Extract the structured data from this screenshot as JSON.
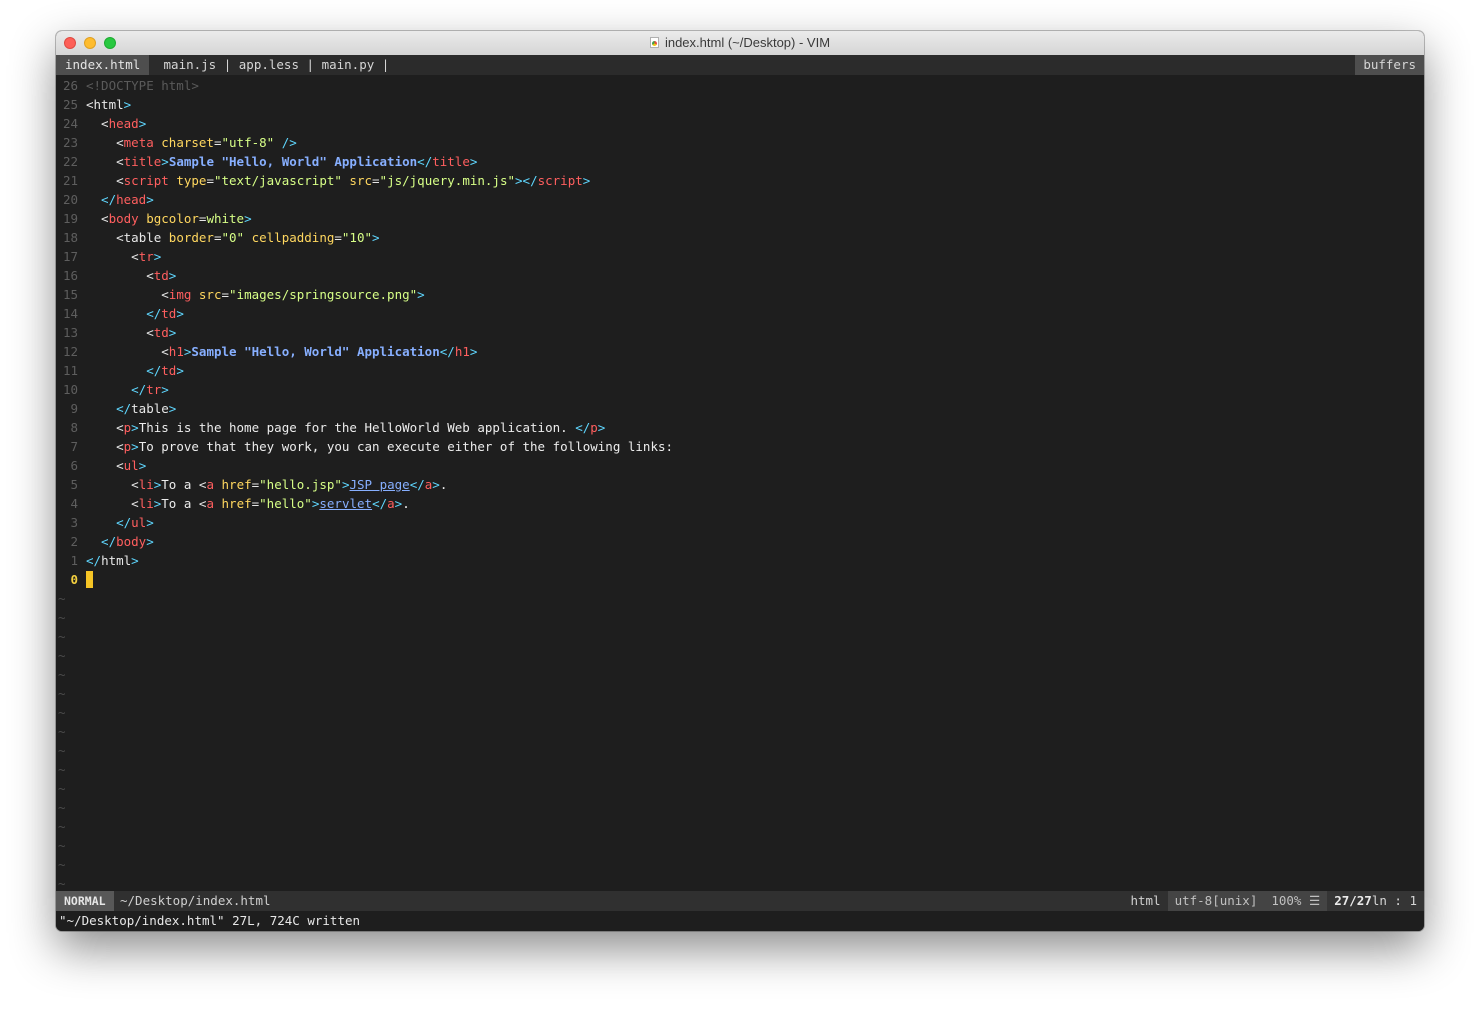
{
  "window": {
    "title": "index.html (~/Desktop) - VIM"
  },
  "tabline": {
    "active_tab": "index.html",
    "other_tabs": " main.js | app.less | main.py |",
    "buffers_label": "buffers"
  },
  "editor": {
    "lines": [
      {
        "num": "26",
        "segs": [
          [
            "<!DOCTYPE html>",
            "#5a5a5a"
          ]
        ]
      },
      {
        "num": "25",
        "segs": [
          [
            "<",
            "#e6e6e6"
          ],
          [
            "html",
            "#e8e8e8"
          ],
          [
            ">",
            "#5fd7ff"
          ]
        ]
      },
      {
        "num": "24",
        "segs": [
          [
            "  <",
            "#e6e6e6"
          ],
          [
            "head",
            "#ff5f5f"
          ],
          [
            ">",
            "#5fd7ff"
          ]
        ]
      },
      {
        "num": "23",
        "segs": [
          [
            "    <",
            "#e6e6e6"
          ],
          [
            "meta ",
            "#ff5f5f"
          ],
          [
            "charset",
            "#ffd75f"
          ],
          [
            "=",
            "#e6e6e6"
          ],
          [
            "\"utf-8\"",
            "#d7ff87"
          ],
          [
            " />",
            "#5fd7ff"
          ]
        ]
      },
      {
        "num": "22",
        "segs": [
          [
            "    <",
            "#e6e6e6"
          ],
          [
            "title",
            "#ff5f5f"
          ],
          [
            ">",
            "#5fd7ff"
          ],
          [
            "Sample \"Hello, World\" Application",
            "#87afff",
            "bold"
          ],
          [
            "</",
            "#5fd7ff"
          ],
          [
            "title",
            "#ff5f5f"
          ],
          [
            ">",
            "#5fd7ff"
          ]
        ]
      },
      {
        "num": "21",
        "segs": [
          [
            "    <",
            "#e6e6e6"
          ],
          [
            "script ",
            "#ff5f5f"
          ],
          [
            "type",
            "#ffd75f"
          ],
          [
            "=",
            "#e6e6e6"
          ],
          [
            "\"text/javascript\"",
            "#d7ff87"
          ],
          [
            " src",
            "#ffd75f"
          ],
          [
            "=",
            "#e6e6e6"
          ],
          [
            "\"js/jquery.min.js\"",
            "#d7ff87"
          ],
          [
            ">",
            "#5fd7ff"
          ],
          [
            "</",
            "#5fd7ff"
          ],
          [
            "script",
            "#ff5f5f"
          ],
          [
            ">",
            "#5fd7ff"
          ]
        ]
      },
      {
        "num": "20",
        "segs": [
          [
            "  </",
            "#5fd7ff"
          ],
          [
            "head",
            "#ff5f5f"
          ],
          [
            ">",
            "#5fd7ff"
          ]
        ]
      },
      {
        "num": "19",
        "segs": [
          [
            "  <",
            "#e6e6e6"
          ],
          [
            "body ",
            "#ff5f5f"
          ],
          [
            "bgcolor",
            "#ffd75f"
          ],
          [
            "=",
            "#e6e6e6"
          ],
          [
            "white",
            "#d7ff87"
          ],
          [
            ">",
            "#5fd7ff"
          ]
        ]
      },
      {
        "num": "18",
        "segs": [
          [
            "    <",
            "#e6e6e6"
          ],
          [
            "table ",
            "#e8e8e8"
          ],
          [
            "border",
            "#ffd75f"
          ],
          [
            "=",
            "#e6e6e6"
          ],
          [
            "\"0\"",
            "#d7ff87"
          ],
          [
            " cellpadding",
            "#ffd75f"
          ],
          [
            "=",
            "#e6e6e6"
          ],
          [
            "\"10\"",
            "#d7ff87"
          ],
          [
            ">",
            "#5fd7ff"
          ]
        ]
      },
      {
        "num": "17",
        "segs": [
          [
            "      <",
            "#e6e6e6"
          ],
          [
            "tr",
            "#ff5f5f"
          ],
          [
            ">",
            "#5fd7ff"
          ]
        ]
      },
      {
        "num": "16",
        "segs": [
          [
            "        <",
            "#e6e6e6"
          ],
          [
            "td",
            "#ff5f5f"
          ],
          [
            ">",
            "#5fd7ff"
          ]
        ]
      },
      {
        "num": "15",
        "segs": [
          [
            "          <",
            "#e6e6e6"
          ],
          [
            "img ",
            "#ff5f5f"
          ],
          [
            "src",
            "#ffd75f"
          ],
          [
            "=",
            "#e6e6e6"
          ],
          [
            "\"images/springsource.png\"",
            "#d7ff87"
          ],
          [
            ">",
            "#5fd7ff"
          ]
        ]
      },
      {
        "num": "14",
        "segs": [
          [
            "        </",
            "#5fd7ff"
          ],
          [
            "td",
            "#ff5f5f"
          ],
          [
            ">",
            "#5fd7ff"
          ]
        ]
      },
      {
        "num": "13",
        "segs": [
          [
            "        <",
            "#e6e6e6"
          ],
          [
            "td",
            "#ff5f5f"
          ],
          [
            ">",
            "#5fd7ff"
          ]
        ]
      },
      {
        "num": "12",
        "segs": [
          [
            "          <",
            "#e6e6e6"
          ],
          [
            "h1",
            "#ff5f5f"
          ],
          [
            ">",
            "#5fd7ff"
          ],
          [
            "Sample \"Hello, World\" Application",
            "#87afff",
            "bold"
          ],
          [
            "</",
            "#5fd7ff"
          ],
          [
            "h1",
            "#ff5f5f"
          ],
          [
            ">",
            "#5fd7ff"
          ]
        ]
      },
      {
        "num": "11",
        "segs": [
          [
            "        </",
            "#5fd7ff"
          ],
          [
            "td",
            "#ff5f5f"
          ],
          [
            ">",
            "#5fd7ff"
          ]
        ]
      },
      {
        "num": "10",
        "segs": [
          [
            "      </",
            "#5fd7ff"
          ],
          [
            "tr",
            "#ff5f5f"
          ],
          [
            ">",
            "#5fd7ff"
          ]
        ]
      },
      {
        "num": "9",
        "segs": [
          [
            "    </",
            "#5fd7ff"
          ],
          [
            "table",
            "#e8e8e8"
          ],
          [
            ">",
            "#5fd7ff"
          ]
        ]
      },
      {
        "num": "8",
        "segs": [
          [
            "    <",
            "#e6e6e6"
          ],
          [
            "p",
            "#ff5f5f"
          ],
          [
            ">",
            "#5fd7ff"
          ],
          [
            "This is the home page for the HelloWorld Web application. ",
            "#ececec"
          ],
          [
            "</",
            "#5fd7ff"
          ],
          [
            "p",
            "#ff5f5f"
          ],
          [
            ">",
            "#5fd7ff"
          ]
        ]
      },
      {
        "num": "7",
        "segs": [
          [
            "    <",
            "#e6e6e6"
          ],
          [
            "p",
            "#ff5f5f"
          ],
          [
            ">",
            "#5fd7ff"
          ],
          [
            "To prove that they work, you can execute either of the following links:",
            "#ececec"
          ]
        ]
      },
      {
        "num": "6",
        "segs": [
          [
            "    <",
            "#e6e6e6"
          ],
          [
            "ul",
            "#ff5f5f"
          ],
          [
            ">",
            "#5fd7ff"
          ]
        ]
      },
      {
        "num": "5",
        "segs": [
          [
            "      <",
            "#e6e6e6"
          ],
          [
            "li",
            "#ff5f5f"
          ],
          [
            ">",
            "#5fd7ff"
          ],
          [
            "To a ",
            "#ececec"
          ],
          [
            "<",
            "#e6e6e6"
          ],
          [
            "a ",
            "#ff5f5f"
          ],
          [
            "href",
            "#ffd75f"
          ],
          [
            "=",
            "#e6e6e6"
          ],
          [
            "\"hello.jsp\"",
            "#d7ff87"
          ],
          [
            ">",
            "#5fd7ff"
          ],
          [
            "JSP page",
            "#87afff",
            "underline"
          ],
          [
            "</",
            "#5fd7ff"
          ],
          [
            "a",
            "#ff5f5f"
          ],
          [
            ">",
            "#5fd7ff"
          ],
          [
            ".",
            "#ececec"
          ]
        ]
      },
      {
        "num": "4",
        "segs": [
          [
            "      <",
            "#e6e6e6"
          ],
          [
            "li",
            "#ff5f5f"
          ],
          [
            ">",
            "#5fd7ff"
          ],
          [
            "To a ",
            "#ececec"
          ],
          [
            "<",
            "#e6e6e6"
          ],
          [
            "a ",
            "#ff5f5f"
          ],
          [
            "href",
            "#ffd75f"
          ],
          [
            "=",
            "#e6e6e6"
          ],
          [
            "\"hello\"",
            "#d7ff87"
          ],
          [
            ">",
            "#5fd7ff"
          ],
          [
            "servlet",
            "#87afff",
            "underline"
          ],
          [
            "</",
            "#5fd7ff"
          ],
          [
            "a",
            "#ff5f5f"
          ],
          [
            ">",
            "#5fd7ff"
          ],
          [
            ".",
            "#ececec"
          ]
        ]
      },
      {
        "num": "3",
        "segs": [
          [
            "    </",
            "#5fd7ff"
          ],
          [
            "ul",
            "#ff5f5f"
          ],
          [
            ">",
            "#5fd7ff"
          ]
        ]
      },
      {
        "num": "2",
        "segs": [
          [
            "  </",
            "#5fd7ff"
          ],
          [
            "body",
            "#ff5f5f"
          ],
          [
            ">",
            "#5fd7ff"
          ]
        ]
      },
      {
        "num": "1",
        "segs": [
          [
            "</",
            "#5fd7ff"
          ],
          [
            "html",
            "#e8e8e8"
          ],
          [
            ">",
            "#5fd7ff"
          ]
        ]
      },
      {
        "num": "0",
        "current": true,
        "segs": []
      }
    ],
    "tilde_count": 16,
    "tilde_char": "~"
  },
  "statusline": {
    "mode": "NORMAL",
    "file": "~/Desktop/index.html",
    "filetype": "html",
    "encoding": "utf-8[unix]",
    "percent": "100% ☰",
    "position": "27/27",
    "position_suffix": " ln  :  1"
  },
  "cmdline": {
    "message": "\"~/Desktop/index.html\" 27L, 724C written"
  }
}
